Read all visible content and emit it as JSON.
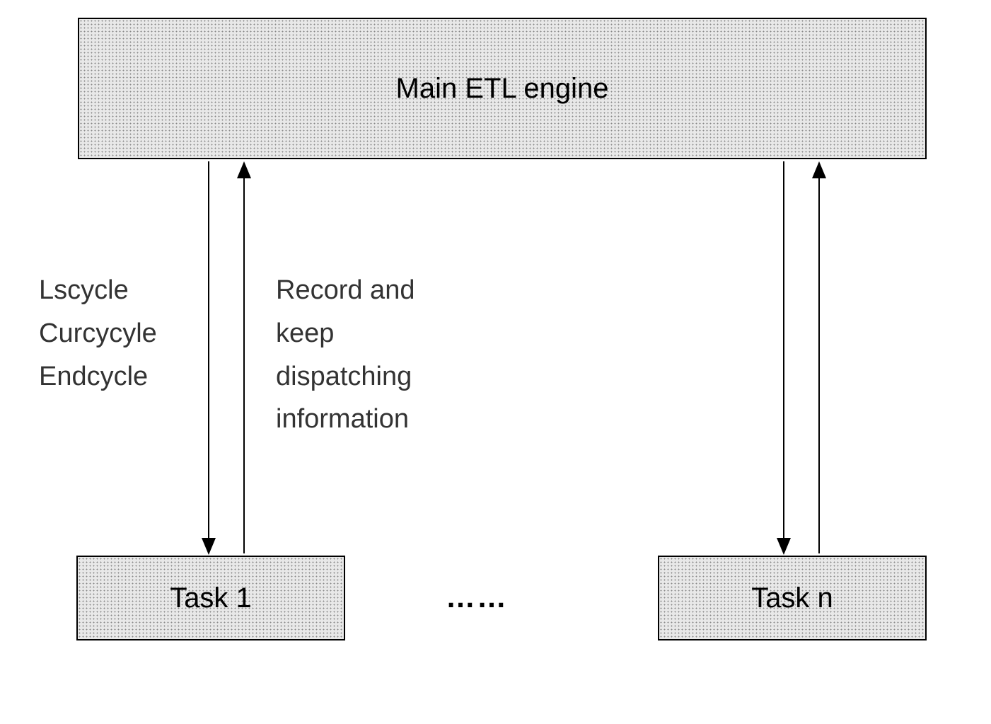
{
  "main_engine": {
    "label": "Main ETL engine"
  },
  "tasks": {
    "task1": "Task 1",
    "taskn": "Task n",
    "ellipsis": "……"
  },
  "left_labels": {
    "line1": "Lscycle",
    "line2": "Curcycyle",
    "line3": "Endcycle"
  },
  "middle_labels": {
    "line1": "Record and",
    "line2": "keep",
    "line3": "dispatching",
    "line4": "information"
  }
}
